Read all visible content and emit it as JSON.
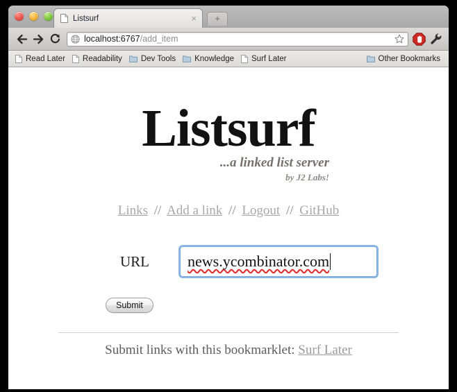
{
  "window": {
    "traffic_lights": [
      "close",
      "minimize",
      "zoom"
    ]
  },
  "browser": {
    "tab": {
      "title": "Listsurf",
      "favicon": "page-icon",
      "close_label": "×"
    },
    "new_tab_label": "+",
    "toolbar": {
      "back_label": "←",
      "forward_label": "→",
      "reload_label": "↻",
      "omnibox": {
        "host": "localhost:6767",
        "path": "/add_item",
        "globe_icon": "globe-icon",
        "star_icon": "star-icon"
      },
      "extension_icon": "adblock-stop-hand-icon",
      "menu_icon": "wrench-icon"
    },
    "bookmarks": [
      {
        "label": "Read Later",
        "icon": "page-icon"
      },
      {
        "label": "Readability",
        "icon": "page-icon"
      },
      {
        "label": "Dev Tools",
        "icon": "folder-icon"
      },
      {
        "label": "Knowledge",
        "icon": "folder-icon"
      },
      {
        "label": "Surf Later",
        "icon": "page-icon"
      },
      {
        "label": "Other Bookmarks",
        "icon": "folder-icon"
      }
    ]
  },
  "page": {
    "logo": "Listsurf",
    "tagline": "...a linked list server",
    "byline": "by J2 Labs!",
    "nav": {
      "separator": "//",
      "links": [
        {
          "label": "Links"
        },
        {
          "label": "Add a link"
        },
        {
          "label": "Logout"
        },
        {
          "label": "GitHub"
        }
      ]
    },
    "form": {
      "url_label": "URL",
      "url_value": "news.ycombinator.com",
      "url_placeholder": "",
      "submit_label": "Submit"
    },
    "footer": {
      "text": "Submit links with this bookmarklet:",
      "link_label": "Surf Later"
    }
  },
  "colors": {
    "focus_ring": "#7aaade",
    "link_gray": "#a8a8a8",
    "logo_black": "#121212",
    "tagline_gray": "#77716d"
  }
}
